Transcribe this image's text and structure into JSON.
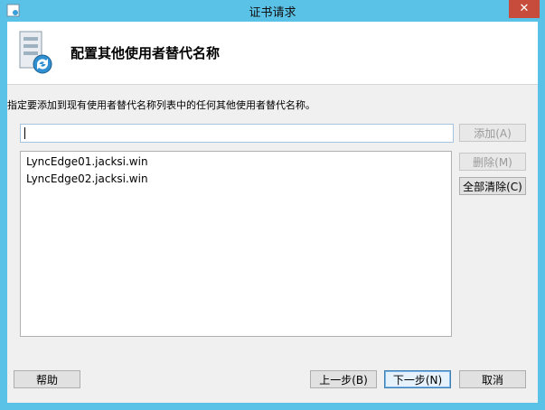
{
  "window": {
    "title": "证书请求",
    "close_label": "✕"
  },
  "header": {
    "title": "配置其他使用者替代名称"
  },
  "instruction": "指定要添加到现有使用者替代名称列表中的任何其他使用者替代名称。",
  "name_input": {
    "value": ""
  },
  "buttons": {
    "add": "添加(A)",
    "remove": "删除(M)",
    "clear_all": "全部清除(C)",
    "help": "帮助",
    "back": "上一步(B)",
    "next": "下一步(N)",
    "cancel": "取消"
  },
  "alt_names": [
    "LyncEdge01.jacksi.win",
    "LyncEdge02.jacksi.win"
  ]
}
